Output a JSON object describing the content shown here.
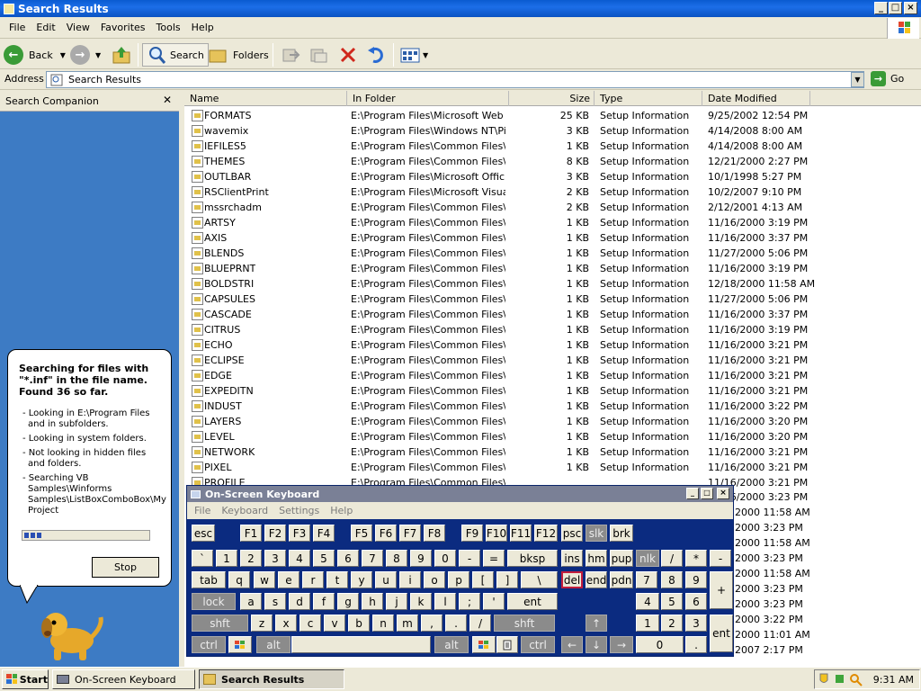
{
  "window": {
    "title": "Search Results"
  },
  "menu": [
    "File",
    "Edit",
    "View",
    "Favorites",
    "Tools",
    "Help"
  ],
  "toolbar": {
    "back_label": "Back",
    "search_label": "Search",
    "folders_label": "Folders"
  },
  "address": {
    "label": "Address",
    "value": "Search Results",
    "go_label": "Go"
  },
  "search_companion": {
    "header": "Search Companion",
    "message": "Searching for files with \"*.inf\" in the file name. Found 36 so far.",
    "details": [
      "- Looking in E:\\Program Files and in subfolders.",
      "- Looking in system folders.",
      "- Not looking in hidden files and folders.",
      "- Searching VB Samples\\Winforms Samples\\ListBoxComboBox\\My Project"
    ],
    "progress": 0.15,
    "stop_label": "Stop"
  },
  "columns": [
    "Name",
    "In Folder",
    "Size",
    "Type",
    "Date Modified"
  ],
  "files": [
    {
      "name": "FORMATS",
      "folder": "E:\\Program Files\\Microsoft Web ...",
      "size": "25 KB",
      "type": "Setup Information",
      "date": "9/25/2002 12:54 PM"
    },
    {
      "name": "wavemix",
      "folder": "E:\\Program Files\\Windows NT\\Pi...",
      "size": "3 KB",
      "type": "Setup Information",
      "date": "4/14/2008 8:00 AM"
    },
    {
      "name": "IEFILES5",
      "folder": "E:\\Program Files\\Common Files\\...",
      "size": "1 KB",
      "type": "Setup Information",
      "date": "4/14/2008 8:00 AM"
    },
    {
      "name": "THEMES",
      "folder": "E:\\Program Files\\Common Files\\...",
      "size": "8 KB",
      "type": "Setup Information",
      "date": "12/21/2000 2:27 PM"
    },
    {
      "name": "OUTLBAR",
      "folder": "E:\\Program Files\\Microsoft Offic...",
      "size": "3 KB",
      "type": "Setup Information",
      "date": "10/1/1998 5:27 PM"
    },
    {
      "name": "RSClientPrint",
      "folder": "E:\\Program Files\\Microsoft Visual...",
      "size": "2 KB",
      "type": "Setup Information",
      "date": "10/2/2007 9:10 PM"
    },
    {
      "name": "mssrchadm",
      "folder": "E:\\Program Files\\Common Files\\...",
      "size": "2 KB",
      "type": "Setup Information",
      "date": "2/12/2001 4:13 AM"
    },
    {
      "name": "ARTSY",
      "folder": "E:\\Program Files\\Common Files\\...",
      "size": "1 KB",
      "type": "Setup Information",
      "date": "11/16/2000 3:19 PM"
    },
    {
      "name": "AXIS",
      "folder": "E:\\Program Files\\Common Files\\...",
      "size": "1 KB",
      "type": "Setup Information",
      "date": "11/16/2000 3:37 PM"
    },
    {
      "name": "BLENDS",
      "folder": "E:\\Program Files\\Common Files\\...",
      "size": "1 KB",
      "type": "Setup Information",
      "date": "11/27/2000 5:06 PM"
    },
    {
      "name": "BLUEPRNT",
      "folder": "E:\\Program Files\\Common Files\\...",
      "size": "1 KB",
      "type": "Setup Information",
      "date": "11/16/2000 3:19 PM"
    },
    {
      "name": "BOLDSTRI",
      "folder": "E:\\Program Files\\Common Files\\...",
      "size": "1 KB",
      "type": "Setup Information",
      "date": "12/18/2000 11:58 AM"
    },
    {
      "name": "CAPSULES",
      "folder": "E:\\Program Files\\Common Files\\...",
      "size": "1 KB",
      "type": "Setup Information",
      "date": "11/27/2000 5:06 PM"
    },
    {
      "name": "CASCADE",
      "folder": "E:\\Program Files\\Common Files\\...",
      "size": "1 KB",
      "type": "Setup Information",
      "date": "11/16/2000 3:37 PM"
    },
    {
      "name": "CITRUS",
      "folder": "E:\\Program Files\\Common Files\\...",
      "size": "1 KB",
      "type": "Setup Information",
      "date": "11/16/2000 3:19 PM"
    },
    {
      "name": "ECHO",
      "folder": "E:\\Program Files\\Common Files\\...",
      "size": "1 KB",
      "type": "Setup Information",
      "date": "11/16/2000 3:21 PM"
    },
    {
      "name": "ECLIPSE",
      "folder": "E:\\Program Files\\Common Files\\...",
      "size": "1 KB",
      "type": "Setup Information",
      "date": "11/16/2000 3:21 PM"
    },
    {
      "name": "EDGE",
      "folder": "E:\\Program Files\\Common Files\\...",
      "size": "1 KB",
      "type": "Setup Information",
      "date": "11/16/2000 3:21 PM"
    },
    {
      "name": "EXPEDITN",
      "folder": "E:\\Program Files\\Common Files\\...",
      "size": "1 KB",
      "type": "Setup Information",
      "date": "11/16/2000 3:21 PM"
    },
    {
      "name": "INDUST",
      "folder": "E:\\Program Files\\Common Files\\...",
      "size": "1 KB",
      "type": "Setup Information",
      "date": "11/16/2000 3:22 PM"
    },
    {
      "name": "LAYERS",
      "folder": "E:\\Program Files\\Common Files\\...",
      "size": "1 KB",
      "type": "Setup Information",
      "date": "11/16/2000 3:20 PM"
    },
    {
      "name": "LEVEL",
      "folder": "E:\\Program Files\\Common Files\\...",
      "size": "1 KB",
      "type": "Setup Information",
      "date": "11/16/2000 3:20 PM"
    },
    {
      "name": "NETWORK",
      "folder": "E:\\Program Files\\Common Files\\...",
      "size": "1 KB",
      "type": "Setup Information",
      "date": "11/16/2000 3:21 PM"
    },
    {
      "name": "PIXEL",
      "folder": "E:\\Program Files\\Common Files\\...",
      "size": "1 KB",
      "type": "Setup Information",
      "date": "11/16/2000 3:21 PM"
    },
    {
      "name": "PROFILE",
      "folder": "E:\\Program Files\\Common Files\\...",
      "size": "",
      "type": "",
      "date": "11/16/2000 3:21 PM"
    }
  ],
  "hidden_date_fragments": [
    "11/16/2000 3:23 PM",
    "2000 11:58 AM",
    "2000 3:23 PM",
    "2000 11:58 AM",
    "2000 3:23 PM",
    "2000 11:58 AM",
    "2000 3:23 PM",
    "2000 3:23 PM",
    "2000 3:22 PM",
    "2000 11:01 AM",
    "2007 2:17 PM"
  ],
  "osk": {
    "title": "On-Screen Keyboard",
    "menu": [
      "File",
      "Keyboard",
      "Settings",
      "Help"
    ],
    "rows": {
      "fn": [
        "esc",
        "F1",
        "F2",
        "F3",
        "F4",
        "F5",
        "F6",
        "F7",
        "F8",
        "F9",
        "F10",
        "F11",
        "F12",
        "psc",
        "slk",
        "brk"
      ],
      "num": [
        "`",
        "1",
        "2",
        "3",
        "4",
        "5",
        "6",
        "7",
        "8",
        "9",
        "0",
        "-",
        "=",
        "bksp",
        "ins",
        "hm",
        "pup",
        "nlk",
        "/",
        "*",
        "-"
      ],
      "q": [
        "tab",
        "q",
        "w",
        "e",
        "r",
        "t",
        "y",
        "u",
        "i",
        "o",
        "p",
        "[",
        "]",
        "\\",
        "del",
        "end",
        "pdn",
        "7",
        "8",
        "9",
        "+"
      ],
      "a": [
        "lock",
        "a",
        "s",
        "d",
        "f",
        "g",
        "h",
        "j",
        "k",
        "l",
        ";",
        "'",
        "ent",
        "4",
        "5",
        "6"
      ],
      "z": [
        "shft",
        "z",
        "x",
        "c",
        "v",
        "b",
        "n",
        "m",
        ",",
        ".",
        "/",
        "shft",
        "↑",
        "1",
        "2",
        "3",
        "ent"
      ],
      "sp": [
        "ctrl",
        "alt",
        "alt",
        "ctrl",
        "←",
        "↓",
        "→",
        "0",
        "."
      ]
    }
  },
  "taskbar": {
    "start_label": "Start",
    "tasks": [
      "On-Screen Keyboard",
      "Search Results"
    ],
    "clock": "9:31 AM"
  },
  "colors": {
    "title_blue": "#0b53c2",
    "pane_blue": "#3d7bc4",
    "osk_blue": "#0b2b80",
    "selected_key": "#c41d3c"
  }
}
